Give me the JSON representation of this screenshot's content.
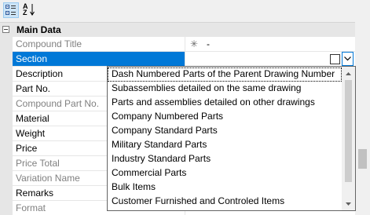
{
  "toolbar": {
    "categorized_icon": "categorized-view-icon",
    "alphabetical_icon": "sort-alphabetical-icon",
    "alphabetical_glyph_top": "A",
    "alphabetical_glyph_bottom": "Z"
  },
  "category": {
    "label": "Main Data"
  },
  "properties": [
    {
      "name": "Compound Title",
      "readonly": true,
      "value_icon": "asterisk-icon",
      "value_icon_glyph": "✳",
      "value": "-"
    },
    {
      "name": "Section",
      "selected": true,
      "value": ""
    },
    {
      "name": "Description"
    },
    {
      "name": "Part No."
    },
    {
      "name": "Compound Part No.",
      "readonly": true
    },
    {
      "name": "Material"
    },
    {
      "name": "Weight"
    },
    {
      "name": "Price"
    },
    {
      "name": "Price Total",
      "readonly": true
    },
    {
      "name": "Variation Name",
      "readonly": true
    },
    {
      "name": "Remarks"
    },
    {
      "name": "Format",
      "readonly": true
    }
  ],
  "dropdown": {
    "items": [
      "Dash Numbered Parts of the Parent Drawing Number",
      "Subassemblies detailed on the same drawing",
      "Parts and assemblies detailed on other drawings",
      "Company Numbered Parts",
      "Company Standard Parts",
      "Military Standard Parts",
      "Industry Standard Parts",
      "Commercial Parts",
      "Bulk Items",
      "Customer Furnished and Controled Items"
    ],
    "highlighted_index": 0
  },
  "colors": {
    "selection": "#0078d7",
    "category_bg": "#e6e6e6",
    "readonly_text": "#808080"
  }
}
